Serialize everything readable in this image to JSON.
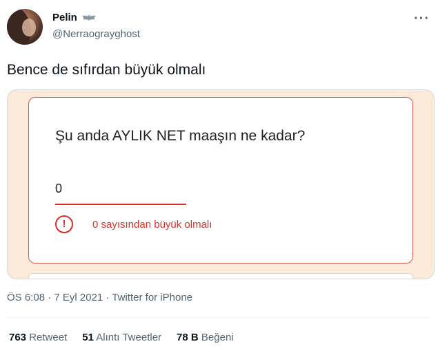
{
  "author": {
    "name": "Pelin",
    "badge_icon": "bat-icon",
    "handle": "@Nerraograyghost"
  },
  "tweet": {
    "text": "Bence de sıfırdan büyük olmalı"
  },
  "form": {
    "question": "Şu anda AYLIK NET maaşın ne kadar?",
    "answer": "0",
    "error_icon": "exclamation-circle-icon",
    "error_message": "0 sayısından büyük olmalı",
    "error_color": "#d93025"
  },
  "meta": {
    "timestamp": "ÖS 6:08 · 7 Eyl 2021 · Twitter for iPhone"
  },
  "stats": {
    "retweets_count": "763",
    "retweets_label": "Retweet",
    "quotes_count": "51",
    "quotes_label": "Alıntı Tweetler",
    "likes_count": "78 B",
    "likes_label": "Beğeni"
  }
}
